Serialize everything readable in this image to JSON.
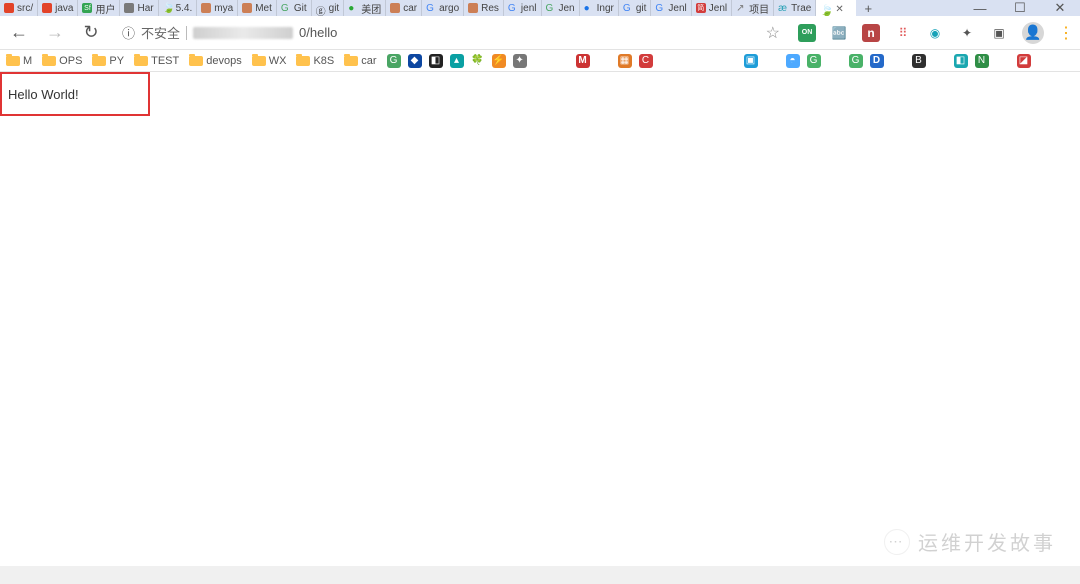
{
  "window": {
    "minimize_glyph": "—",
    "maximize_glyph": "☐",
    "close_glyph": "✕"
  },
  "tabs": [
    {
      "title": "src/",
      "color": "#e24329"
    },
    {
      "title": "java",
      "color": "#e24329"
    },
    {
      "title": "用户",
      "color": "#33a453",
      "badge": "Sf"
    },
    {
      "title": "Har",
      "color": "#7a7a7a"
    },
    {
      "title": "5.4.",
      "color": "#4caf50",
      "glyph": "🍃"
    },
    {
      "title": "mya",
      "color": "#cc7f56"
    },
    {
      "title": "Met",
      "color": "#cc7f56"
    },
    {
      "title": "Git",
      "color": "#4aa564",
      "glyph": "G"
    },
    {
      "title": "git",
      "color": "#333333",
      "glyph": "ⓖ"
    },
    {
      "title": "美团",
      "color": "#2aa836",
      "glyph": "●"
    },
    {
      "title": "car",
      "color": "#cc7f56"
    },
    {
      "title": "argo",
      "color": "#4285f4",
      "glyph": "G"
    },
    {
      "title": "Res",
      "color": "#cc7f56"
    },
    {
      "title": "jenl",
      "color": "#4285f4",
      "glyph": "G"
    },
    {
      "title": "Jen",
      "color": "#4aa564",
      "glyph": "G"
    },
    {
      "title": "Ingr",
      "color": "#1a73e8",
      "glyph": "●"
    },
    {
      "title": "git",
      "color": "#4285f4",
      "glyph": "G"
    },
    {
      "title": "Jenl",
      "color": "#4285f4",
      "glyph": "G"
    },
    {
      "title": "Jenl",
      "color": "#d23c3c",
      "badge": "简"
    },
    {
      "title": "项目",
      "color": "#7a7a7a",
      "glyph": "↗"
    },
    {
      "title": "Trae",
      "color": "#2aa0b5",
      "glyph": "æ"
    }
  ],
  "active_tab": {
    "color": "#6eb33f",
    "glyph": "🍃",
    "close": "✕"
  },
  "new_tab_glyph": "+",
  "nav": {
    "back": "←",
    "forward": "→",
    "refresh": "↻"
  },
  "url": {
    "info_glyph": "ⓘ",
    "security": "不安全",
    "path": "0/hello",
    "star": "☆"
  },
  "addr_icons": {
    "on": "ON",
    "translate": "⇄",
    "n": "n",
    "grid": "⠿",
    "t": "⬚",
    "star_s": "✦",
    "cube": "▣",
    "avatar": "👤",
    "more": "⋮"
  },
  "bookmarks_folders": [
    "M",
    "OPS",
    "PY",
    "TEST",
    "devops",
    "WX",
    "K8S",
    "car"
  ],
  "page_text": "Hello World!",
  "watermark": {
    "wechat": "⋯",
    "text": "运维开发故事"
  }
}
